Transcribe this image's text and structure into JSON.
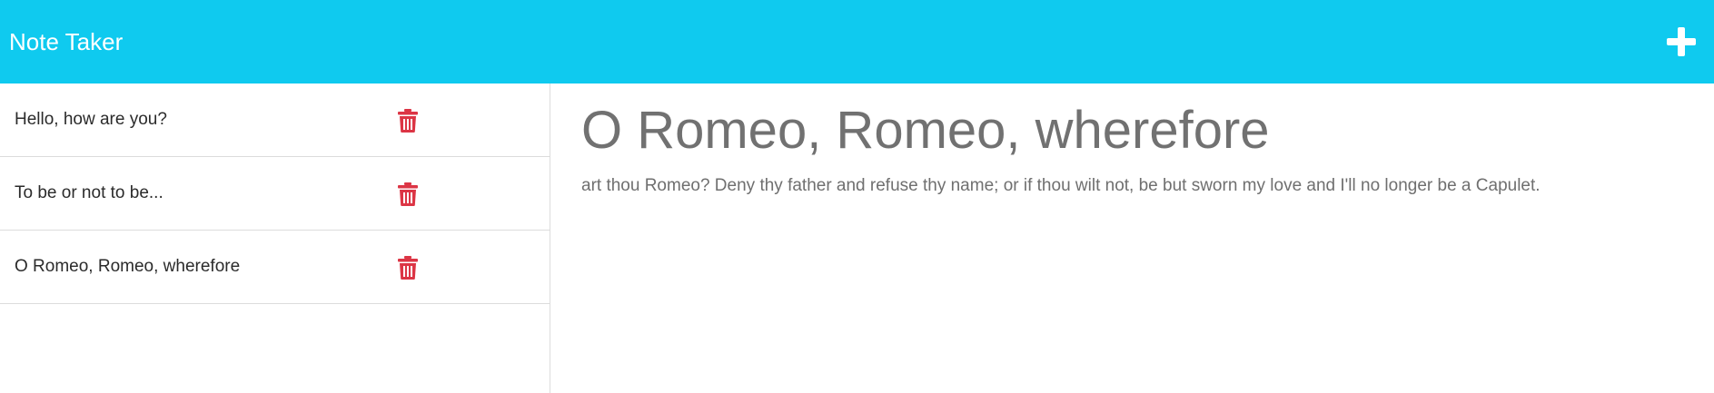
{
  "app": {
    "title": "Note Taker",
    "new_note_icon": "plus-icon"
  },
  "colors": {
    "navbar": "#0fcaef",
    "delete": "#dc3545",
    "heading_text": "#717171"
  },
  "notes": [
    {
      "title": "Hello, how are you?",
      "icon": "trash-icon"
    },
    {
      "title": "To be or not to be...",
      "icon": "trash-icon"
    },
    {
      "title": "O Romeo, Romeo, wherefore",
      "icon": "trash-icon"
    }
  ],
  "active_note": {
    "title": "O Romeo, Romeo, wherefore",
    "text": "art thou Romeo? Deny thy father and refuse thy name; or if thou wilt not, be but sworn my love and I'll no longer be a Capulet."
  }
}
